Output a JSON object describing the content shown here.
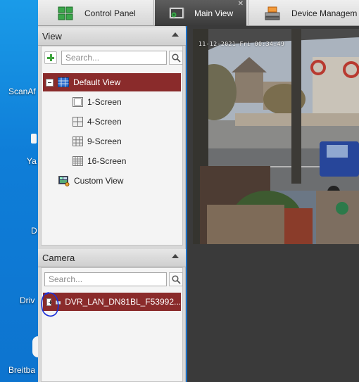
{
  "desktop": {
    "labels": [
      "ScanAf",
      "Ya",
      "D",
      "Driv",
      "Breitba"
    ]
  },
  "tabs": [
    {
      "label": "Control Panel",
      "icon": "control-panel-icon"
    },
    {
      "label": "Main View",
      "icon": "main-view-icon",
      "active": true
    },
    {
      "label": "Device Managem",
      "icon": "device-management-icon"
    }
  ],
  "view_panel": {
    "title": "View",
    "search_placeholder": "Search...",
    "tree": [
      {
        "label": "Default View",
        "selected": true
      },
      {
        "label": "1-Screen"
      },
      {
        "label": "4-Screen"
      },
      {
        "label": "9-Screen"
      },
      {
        "label": "16-Screen"
      },
      {
        "label": "Custom View"
      }
    ]
  },
  "camera_panel": {
    "title": "Camera",
    "search_placeholder": "Search...",
    "devices": [
      {
        "label": "DVR_LAN_DN81BL_F53992...",
        "selected": true
      }
    ]
  },
  "video": {
    "osd_text": "11-12-2021 Fri 00:34:49"
  },
  "colors": {
    "selected_row": "#8a2b2b",
    "active_tab": "#3f3f3f",
    "annotation_circle": "#1a2fd8"
  }
}
